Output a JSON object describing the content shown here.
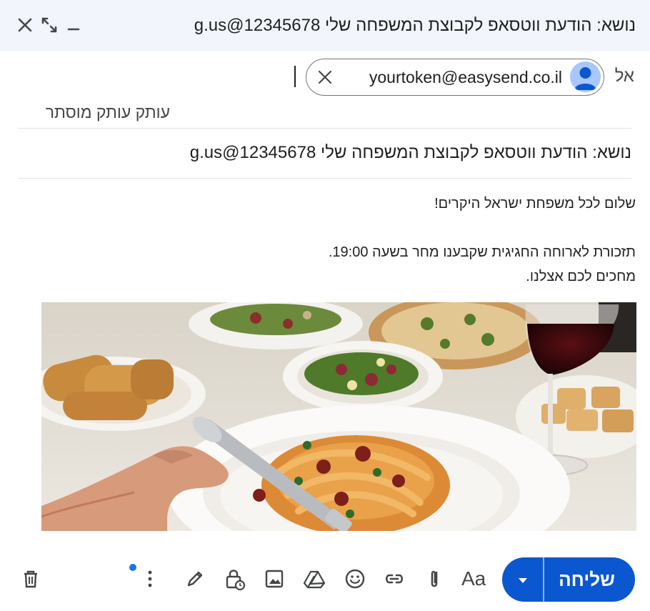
{
  "window": {
    "title": "נושא: הודעת ווטסאפ לקבוצת המשפחה שלי g.us@12345678"
  },
  "recipients": {
    "to_label": "אל",
    "chips": [
      {
        "email": "yourtoken@easysend.co.il"
      }
    ]
  },
  "cc": {
    "text": "עותק עותק מוסתר"
  },
  "subject": {
    "value": "נושא: הודעת ווטסאפ לקבוצת המשפחה שלי g.us@12345678"
  },
  "body": {
    "greeting": "שלום לכל משפחת ישראל היקרים!",
    "line1": "תזכורת לארוחה החגיגית שקבענו מחר בשעה 19:00.",
    "line2": "מחכים לכם אצלנו."
  },
  "toolbar": {
    "send_label": "שליחה",
    "format_label": "Aa",
    "icons": [
      "attach-icon",
      "link-icon",
      "emoji-icon",
      "drive-icon",
      "image-icon",
      "lock-clock-icon",
      "pen-icon",
      "more-vert-icon",
      "trash-icon"
    ]
  },
  "colors": {
    "send": "#0b57d0",
    "titlebar": "#f2f6fc",
    "notification_dot": "#1a73e8"
  }
}
